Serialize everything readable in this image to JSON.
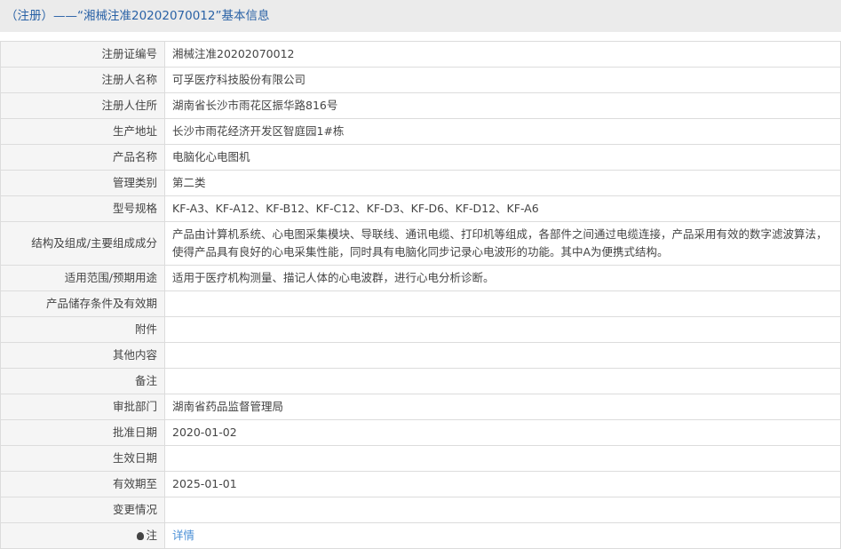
{
  "header": {
    "title": "（注册）——“湘械注准20202070012”基本信息"
  },
  "rows": [
    {
      "label": "注册证编号",
      "value": "湘械注准20202070012"
    },
    {
      "label": "注册人名称",
      "value": "可孚医疗科技股份有限公司"
    },
    {
      "label": "注册人住所",
      "value": "湖南省长沙市雨花区振华路816号"
    },
    {
      "label": "生产地址",
      "value": "长沙市雨花经济开发区智庭园1#栋"
    },
    {
      "label": "产品名称",
      "value": "电脑化心电图机"
    },
    {
      "label": "管理类别",
      "value": "第二类"
    },
    {
      "label": "型号规格",
      "value": "KF-A3、KF-A12、KF-B12、KF-C12、KF-D3、KF-D6、KF-D12、KF-A6"
    },
    {
      "label": "结构及组成/主要组成成分",
      "value": "产品由计算机系统、心电图采集模块、导联线、通讯电缆、打印机等组成，各部件之间通过电缆连接，产品采用有效的数字滤波算法，使得产品具有良好的心电采集性能，同时具有电脑化同步记录心电波形的功能。其中A为便携式结构。"
    },
    {
      "label": "适用范围/预期用途",
      "value": "适用于医疗机构测量、描记人体的心电波群，进行心电分析诊断。"
    },
    {
      "label": "产品储存条件及有效期",
      "value": ""
    },
    {
      "label": "附件",
      "value": ""
    },
    {
      "label": "其他内容",
      "value": ""
    },
    {
      "label": "备注",
      "value": ""
    },
    {
      "label": "审批部门",
      "value": "湖南省药品监督管理局"
    },
    {
      "label": "批准日期",
      "value": "2020-01-02"
    },
    {
      "label": "生效日期",
      "value": ""
    },
    {
      "label": "有效期至",
      "value": "2025-01-01"
    },
    {
      "label": "变更情况",
      "value": ""
    }
  ],
  "note": {
    "label": "注",
    "link": "详情"
  }
}
